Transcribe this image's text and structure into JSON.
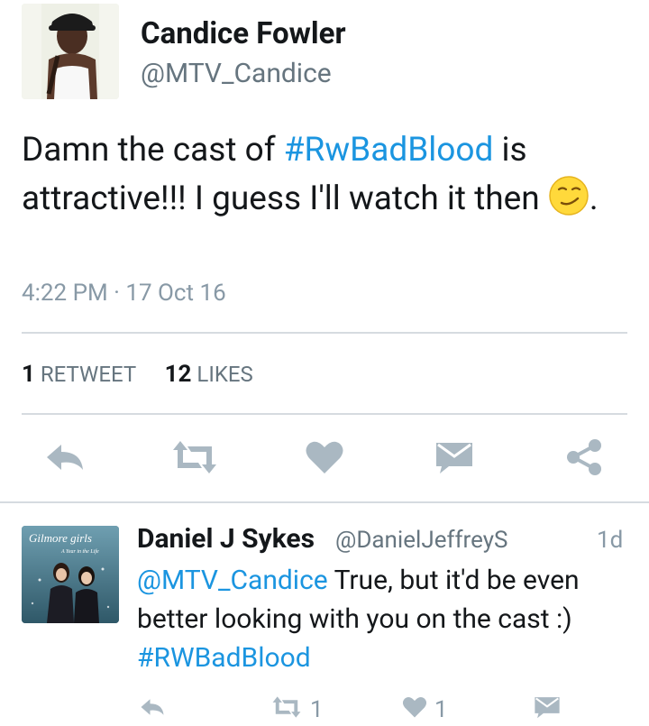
{
  "tweet": {
    "author_name": "Candice Fowler",
    "author_handle": "@MTV_Candice",
    "text_before": "Damn the cast of ",
    "hashtag": "#RwBadBlood",
    "text_after": " is attractive!!! I guess I'll watch it then ",
    "text_end": ".",
    "timestamp": "4:22 PM · 17 Oct 16",
    "retweets_count": "1",
    "retweets_label": "RETWEET",
    "likes_count": "12",
    "likes_label": "LIKES"
  },
  "actions": {
    "reply_icon": "reply-icon",
    "retweet_icon": "retweet-icon",
    "like_icon": "heart-icon",
    "dm_icon": "envelope-icon",
    "share_icon": "share-icon"
  },
  "reply": {
    "author_name": "Daniel J Sykes",
    "author_handle": "@DanielJeffreyS",
    "time": "1d",
    "mention": "@MTV_Candice",
    "text": " True, but it'd be even better looking with you on the cast :)",
    "hashtag": "#RWBadBlood",
    "avatar_text": "Gilmore girls",
    "avatar_subtext": "A Year in the Life",
    "retweet_count": "1",
    "like_count": "1"
  },
  "colors": {
    "link": "#1b95e0",
    "icon": "#aab8c2",
    "divider": "#d6dbe0"
  }
}
